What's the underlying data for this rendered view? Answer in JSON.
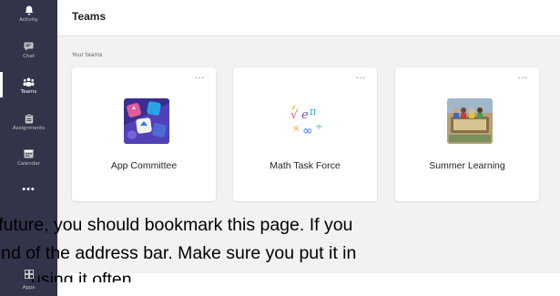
{
  "rail": {
    "items": [
      {
        "label": "Activity",
        "icon": "bell-icon"
      },
      {
        "label": "Chat",
        "icon": "chat-icon"
      },
      {
        "label": "Teams",
        "icon": "teams-icon",
        "active": true
      },
      {
        "label": "Assignments",
        "icon": "assignments-icon"
      },
      {
        "label": "Calendar",
        "icon": "calendar-icon"
      }
    ],
    "more": "•••",
    "apps": {
      "label": "Apps",
      "icon": "apps-icon"
    }
  },
  "header": {
    "title": "Teams"
  },
  "section_label": "Your teams",
  "teams": [
    {
      "name": "App Committee",
      "more": "···"
    },
    {
      "name": "Math Task Force",
      "more": "···"
    },
    {
      "name": "Summer Learning",
      "more": "···"
    }
  ],
  "document": {
    "line1": "e future, you should bookmark this page.  If you",
    "line2": "e end of the address bar.  Make sure you put it in",
    "line3": "using it often."
  },
  "colors": {
    "rail": "#33344a",
    "accent": "#6264a7",
    "background": "#f3f2f1"
  }
}
